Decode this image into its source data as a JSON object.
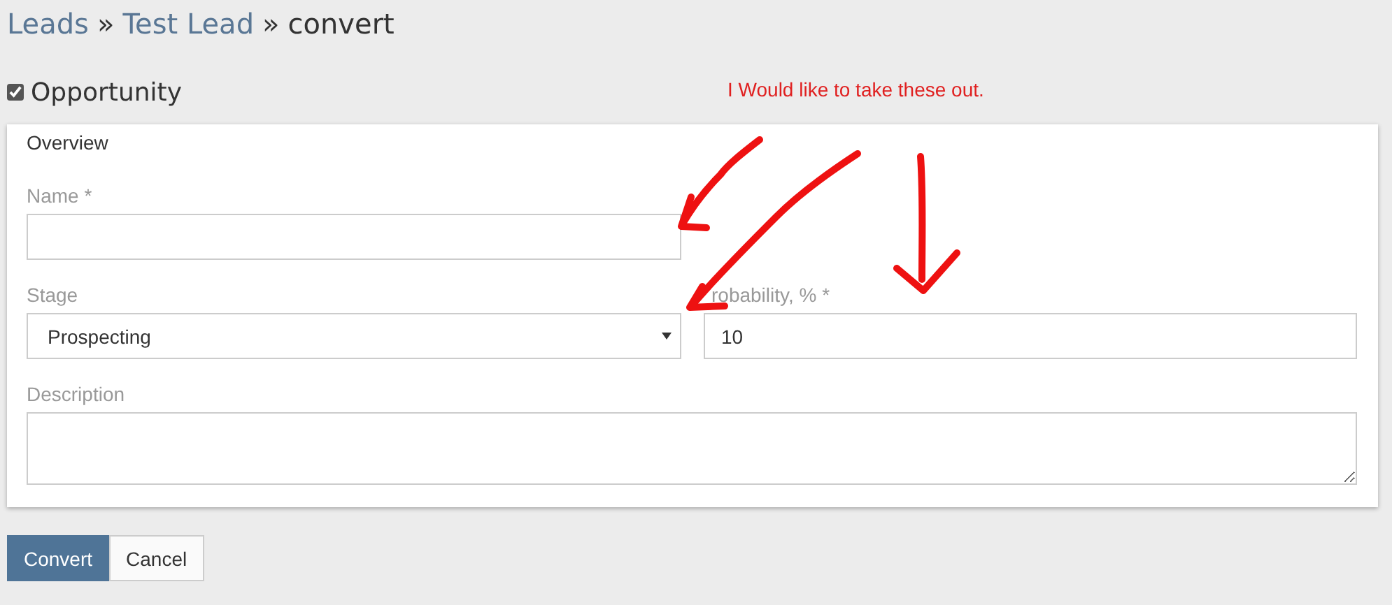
{
  "breadcrumb": [
    {
      "label": "Leads",
      "kind": "link"
    },
    {
      "label": "»",
      "kind": "separator"
    },
    {
      "label": "Test Lead",
      "kind": "link"
    },
    {
      "label": "»",
      "kind": "separator"
    },
    {
      "label": "convert",
      "kind": "current"
    }
  ],
  "opportunity": {
    "label": "Opportunity",
    "checked": true
  },
  "annotation": {
    "note": "I Would like to take these out."
  },
  "panel": {
    "title": "Overview",
    "rows": [
      [
        {
          "label": "Name *",
          "kind": "text"
        }
      ],
      [
        {
          "label": "Stage",
          "kind": "select",
          "value": "Prospecting"
        },
        {
          "label": "robability, % *",
          "kind": "text",
          "value": "10"
        }
      ],
      [
        {
          "label": "Description",
          "kind": "textarea"
        }
      ]
    ]
  },
  "buttons": [
    {
      "label": "Convert",
      "kind": "primary"
    },
    {
      "label": "Cancel",
      "kind": "default"
    }
  ]
}
